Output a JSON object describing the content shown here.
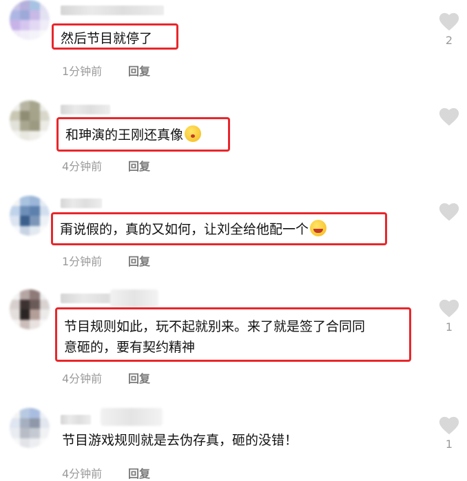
{
  "comments": [
    {
      "text": "然后节目就停了",
      "time": "1分钟前",
      "reply": "回复",
      "likes": "2",
      "emoji": null
    },
    {
      "text": "和珅演的王刚还真像",
      "time": "4分钟前",
      "reply": "回复",
      "likes": "",
      "emoji": "face-blowing-kiss-emoji"
    },
    {
      "text": "甭说假的，真的又如何，让刘全给他配一个",
      "time": "1分钟前",
      "reply": "回复",
      "likes": "",
      "emoji": "rolling-laughing-emoji"
    },
    {
      "text_line1": "节目规则如此，玩不起就别来。来了就是签了合同同",
      "text_line2": "意砸的，要有契约精神",
      "time": "4分钟前",
      "reply": "回复",
      "likes": "1"
    },
    {
      "text": "节目游戏规则就是去伪存真，砸的没错！",
      "time": "4分钟前",
      "reply": "回复",
      "likes": "1"
    }
  ],
  "colors": {
    "highlight_border": "#e8262b",
    "heart": "#d8d8d8",
    "meta": "#9a9a9a"
  },
  "icons": {
    "like": "heart-icon"
  }
}
